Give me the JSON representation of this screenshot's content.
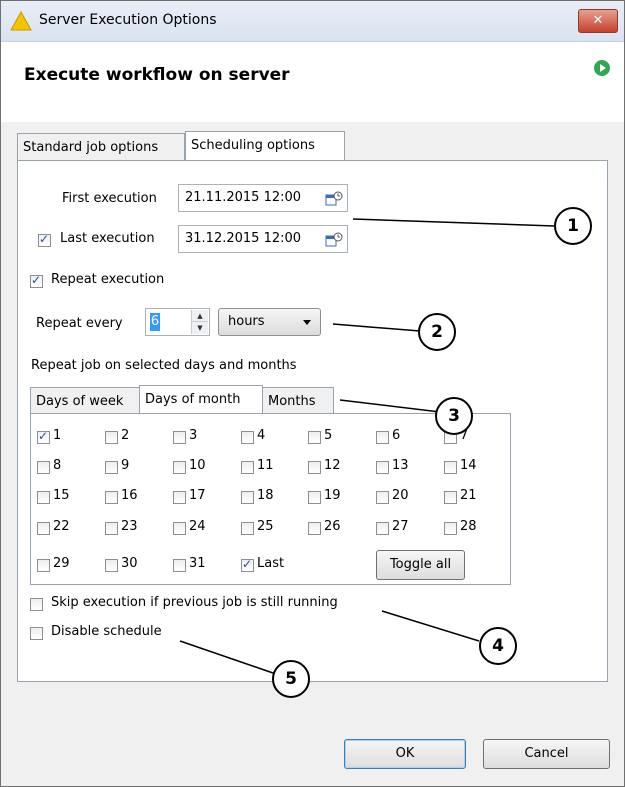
{
  "window": {
    "title": "Server Execution Options",
    "close_label": "✕"
  },
  "header": {
    "title": "Execute workflow on server"
  },
  "tabs": [
    {
      "label": "Standard job options",
      "active": false
    },
    {
      "label": "Scheduling options",
      "active": true
    }
  ],
  "schedule": {
    "first_execution_label": "First execution",
    "first_execution_value": "21.11.2015 12:00",
    "last_execution_label": "Last execution",
    "last_execution_value": "31.12.2015 12:00",
    "last_execution_checked": true,
    "repeat_execution_label": "Repeat execution",
    "repeat_execution_checked": true,
    "repeat_every_label": "Repeat every",
    "repeat_every_value": "6",
    "repeat_unit": "hours",
    "days_months_label": "Repeat job on selected days and months"
  },
  "day_tabs": [
    {
      "label": "Days of week",
      "active": false
    },
    {
      "label": "Days of month",
      "active": true
    },
    {
      "label": "Months",
      "active": false
    }
  ],
  "days": [
    {
      "label": "1",
      "checked": true
    },
    {
      "label": "2",
      "checked": false
    },
    {
      "label": "3",
      "checked": false
    },
    {
      "label": "4",
      "checked": false
    },
    {
      "label": "5",
      "checked": false
    },
    {
      "label": "6",
      "checked": false
    },
    {
      "label": "7",
      "checked": false
    },
    {
      "label": "8",
      "checked": false
    },
    {
      "label": "9",
      "checked": false
    },
    {
      "label": "10",
      "checked": false
    },
    {
      "label": "11",
      "checked": false
    },
    {
      "label": "12",
      "checked": false
    },
    {
      "label": "13",
      "checked": false
    },
    {
      "label": "14",
      "checked": false
    },
    {
      "label": "15",
      "checked": false
    },
    {
      "label": "16",
      "checked": false
    },
    {
      "label": "17",
      "checked": false
    },
    {
      "label": "18",
      "checked": false
    },
    {
      "label": "19",
      "checked": false
    },
    {
      "label": "20",
      "checked": false
    },
    {
      "label": "21",
      "checked": false
    },
    {
      "label": "22",
      "checked": false
    },
    {
      "label": "23",
      "checked": false
    },
    {
      "label": "24",
      "checked": false
    },
    {
      "label": "25",
      "checked": false
    },
    {
      "label": "26",
      "checked": false
    },
    {
      "label": "27",
      "checked": false
    },
    {
      "label": "28",
      "checked": false
    },
    {
      "label": "29",
      "checked": false
    },
    {
      "label": "30",
      "checked": false
    },
    {
      "label": "31",
      "checked": false
    },
    {
      "label": "Last",
      "checked": true
    }
  ],
  "toggle_all_label": "Toggle all",
  "options": {
    "skip_label": "Skip execution if previous job is still running",
    "skip_checked": false,
    "disable_label": "Disable schedule",
    "disable_checked": false
  },
  "footer": {
    "ok_label": "OK",
    "cancel_label": "Cancel"
  },
  "callouts": [
    "1",
    "2",
    "3",
    "4",
    "5"
  ]
}
